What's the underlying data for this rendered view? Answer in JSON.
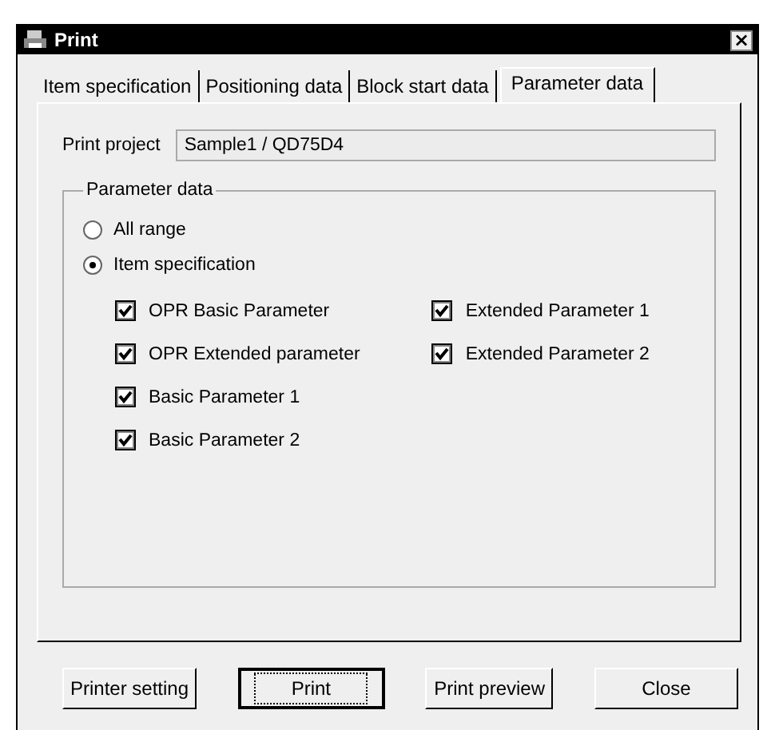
{
  "window": {
    "title": "Print",
    "close": "×"
  },
  "tabs": [
    {
      "label": "Item specification",
      "selected": false
    },
    {
      "label": "Positioning data",
      "selected": false
    },
    {
      "label": "Block start data",
      "selected": false
    },
    {
      "label": "Parameter data",
      "selected": true
    }
  ],
  "print_project": {
    "label": "Print project",
    "value": "Sample1 / QD75D4"
  },
  "group": {
    "title": "Parameter data",
    "radios": [
      {
        "label": "All range",
        "selected": false
      },
      {
        "label": "Item specification",
        "selected": true
      }
    ],
    "checkbox_columns": [
      [
        {
          "label": "OPR Basic Parameter",
          "checked": true
        },
        {
          "label": "OPR Extended parameter",
          "checked": true
        },
        {
          "label": "Basic Parameter 1",
          "checked": true
        },
        {
          "label": "Basic Parameter 2",
          "checked": true
        }
      ],
      [
        {
          "label": "Extended Parameter 1",
          "checked": true
        },
        {
          "label": "Extended Parameter 2",
          "checked": true
        }
      ]
    ]
  },
  "buttons": [
    {
      "label": "Printer setting",
      "default": false
    },
    {
      "label": "Print",
      "default": true
    },
    {
      "label": "Print preview",
      "default": false
    },
    {
      "label": "Close",
      "default": false
    }
  ]
}
